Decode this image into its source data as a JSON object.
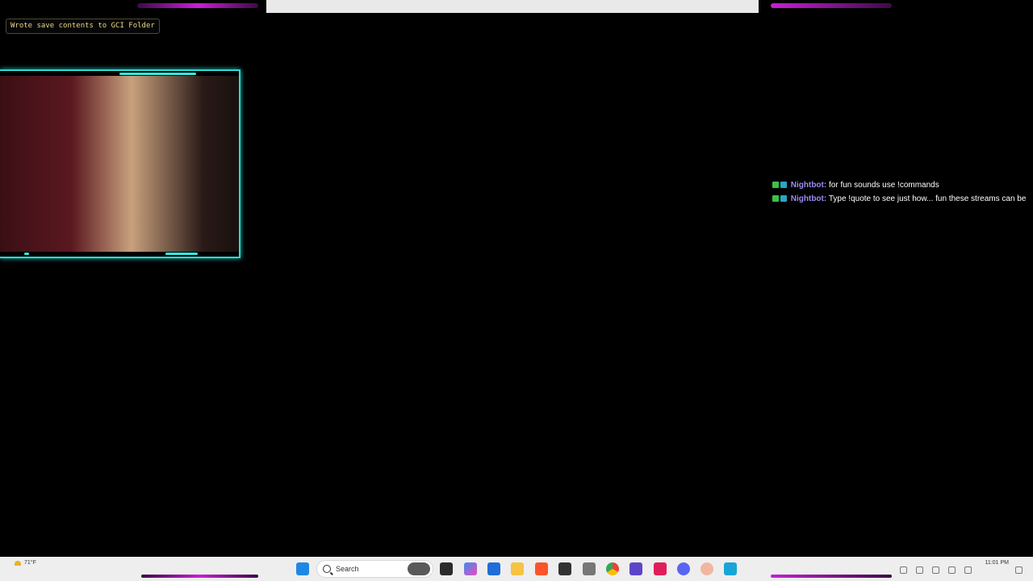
{
  "toast": {
    "message": "Wrote save contents to GCI Folder"
  },
  "chat": {
    "messages": [
      {
        "user": "Nightbot:",
        "text": "for fun sounds use !commands"
      },
      {
        "user": "Nightbot:",
        "text": "Type !quote to see just how... fun these streams can be"
      }
    ]
  },
  "taskbar": {
    "weather": "71°F",
    "search_placeholder": "Search",
    "time": "11:01 PM",
    "icons": [
      "windows-start-icon",
      "task-view-icon",
      "copilot-icon",
      "store-icon",
      "file-explorer-icon",
      "brave-icon",
      "7zip-icon",
      "app-icon",
      "chrome-icon",
      "sound-icon",
      "tiktok-icon",
      "discord-icon",
      "app-icon",
      "dolphin-icon"
    ]
  },
  "colors": {
    "neon_magenta": "#c81fd6",
    "neon_cyan": "#35ece0",
    "chat_user": "#9b8cf2"
  }
}
